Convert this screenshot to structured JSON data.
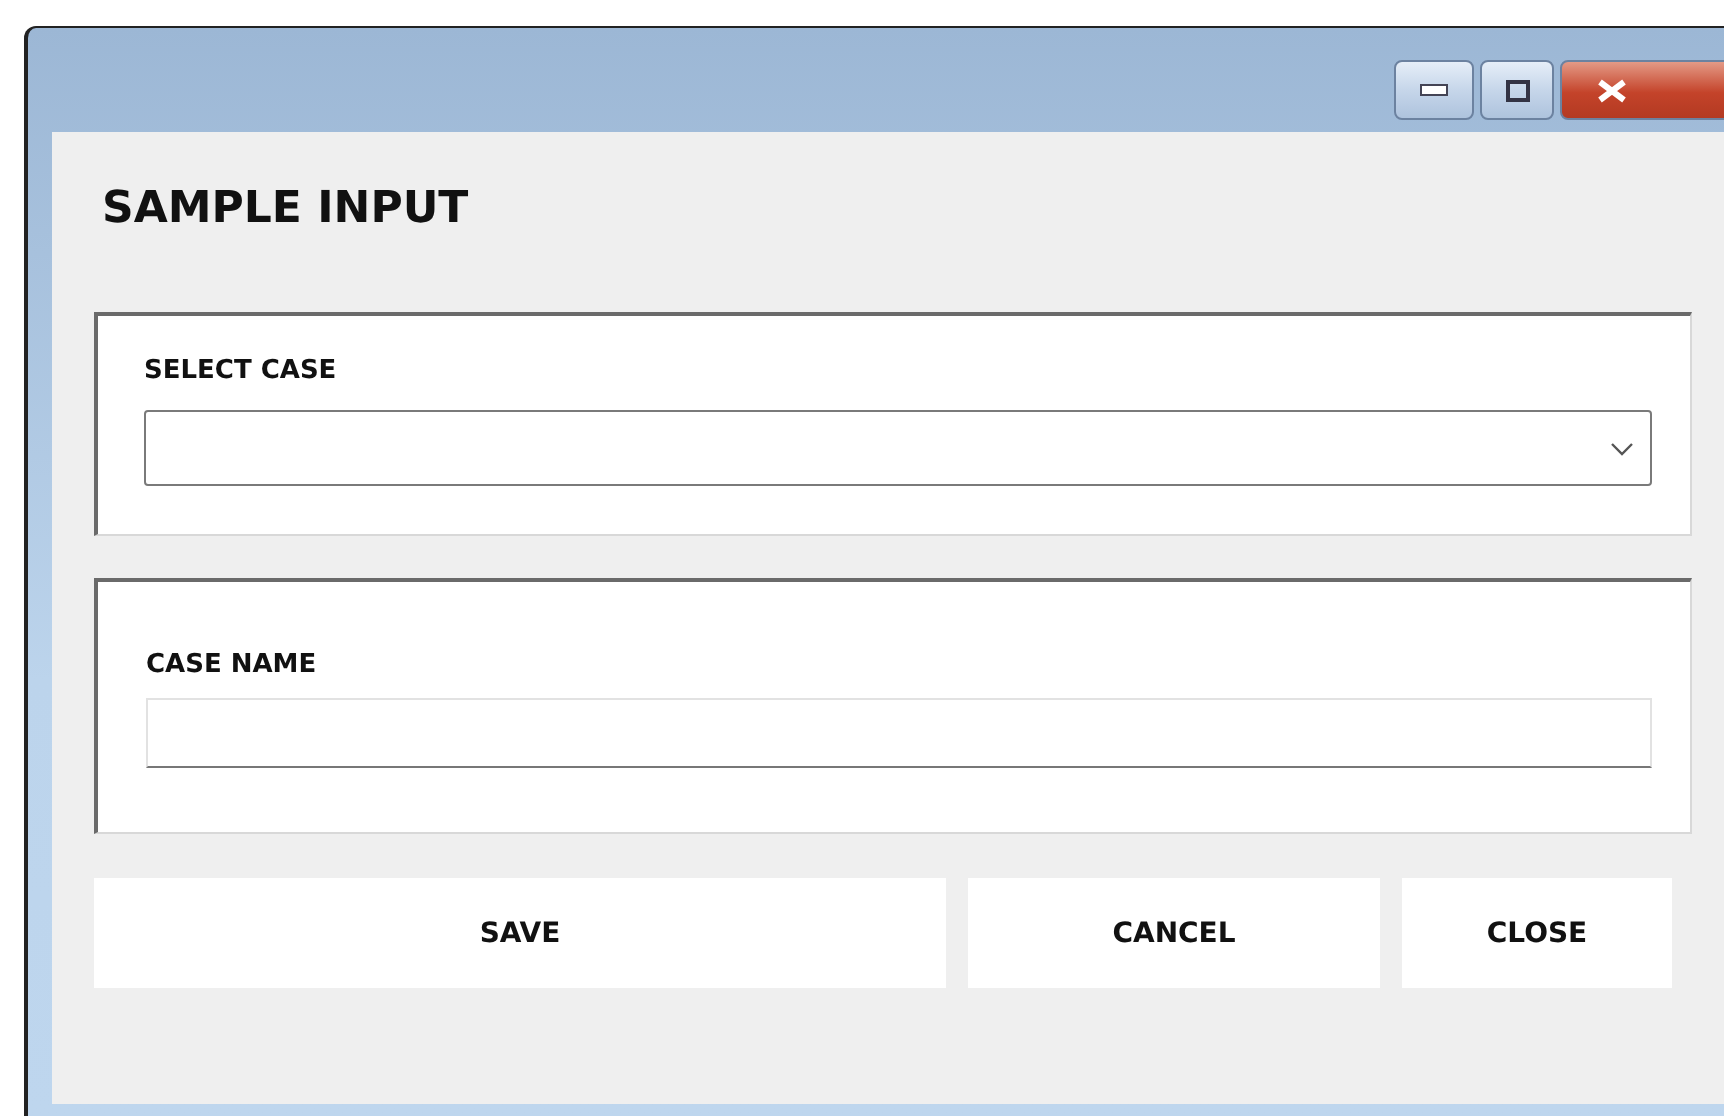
{
  "heading": "SAMPLE INPUT",
  "fields": [
    {
      "kind": "dropdown",
      "label": "SELECT CASE"
    },
    {
      "kind": "text",
      "label": "CASE NAME"
    }
  ],
  "buttons": [
    "SAVE",
    "CANCEL",
    "CLOSE"
  ]
}
